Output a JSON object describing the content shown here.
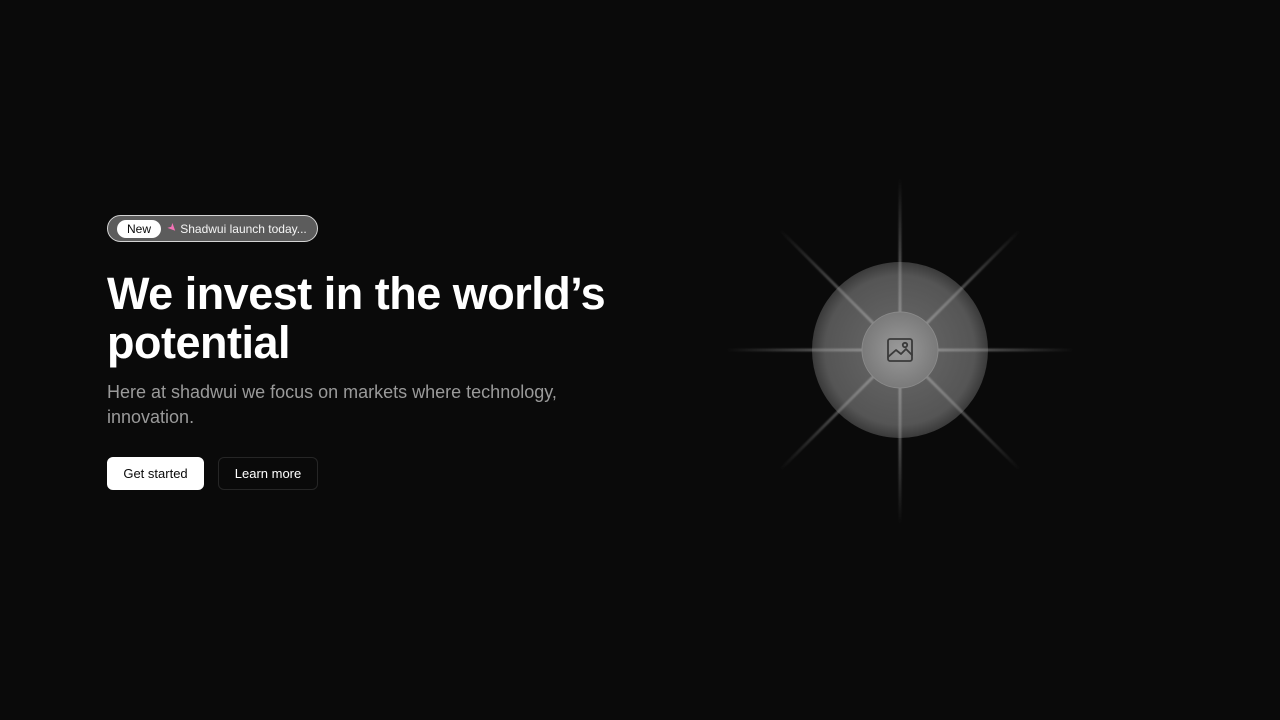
{
  "badge": {
    "tag": "New",
    "icon": "rocket-icon",
    "text": "Shadwui launch today..."
  },
  "hero": {
    "title_line1": "We invest in the world’s",
    "title_line2": "potential",
    "subtitle": "Here at shadwui we focus on markets where technology, innovation."
  },
  "actions": {
    "primary_label": "Get started",
    "secondary_label": "Learn more"
  },
  "visual": {
    "icon": "image-icon"
  },
  "colors": {
    "background": "#0a0a0a",
    "text_primary": "#ffffff",
    "text_muted": "#9a9a9a"
  }
}
